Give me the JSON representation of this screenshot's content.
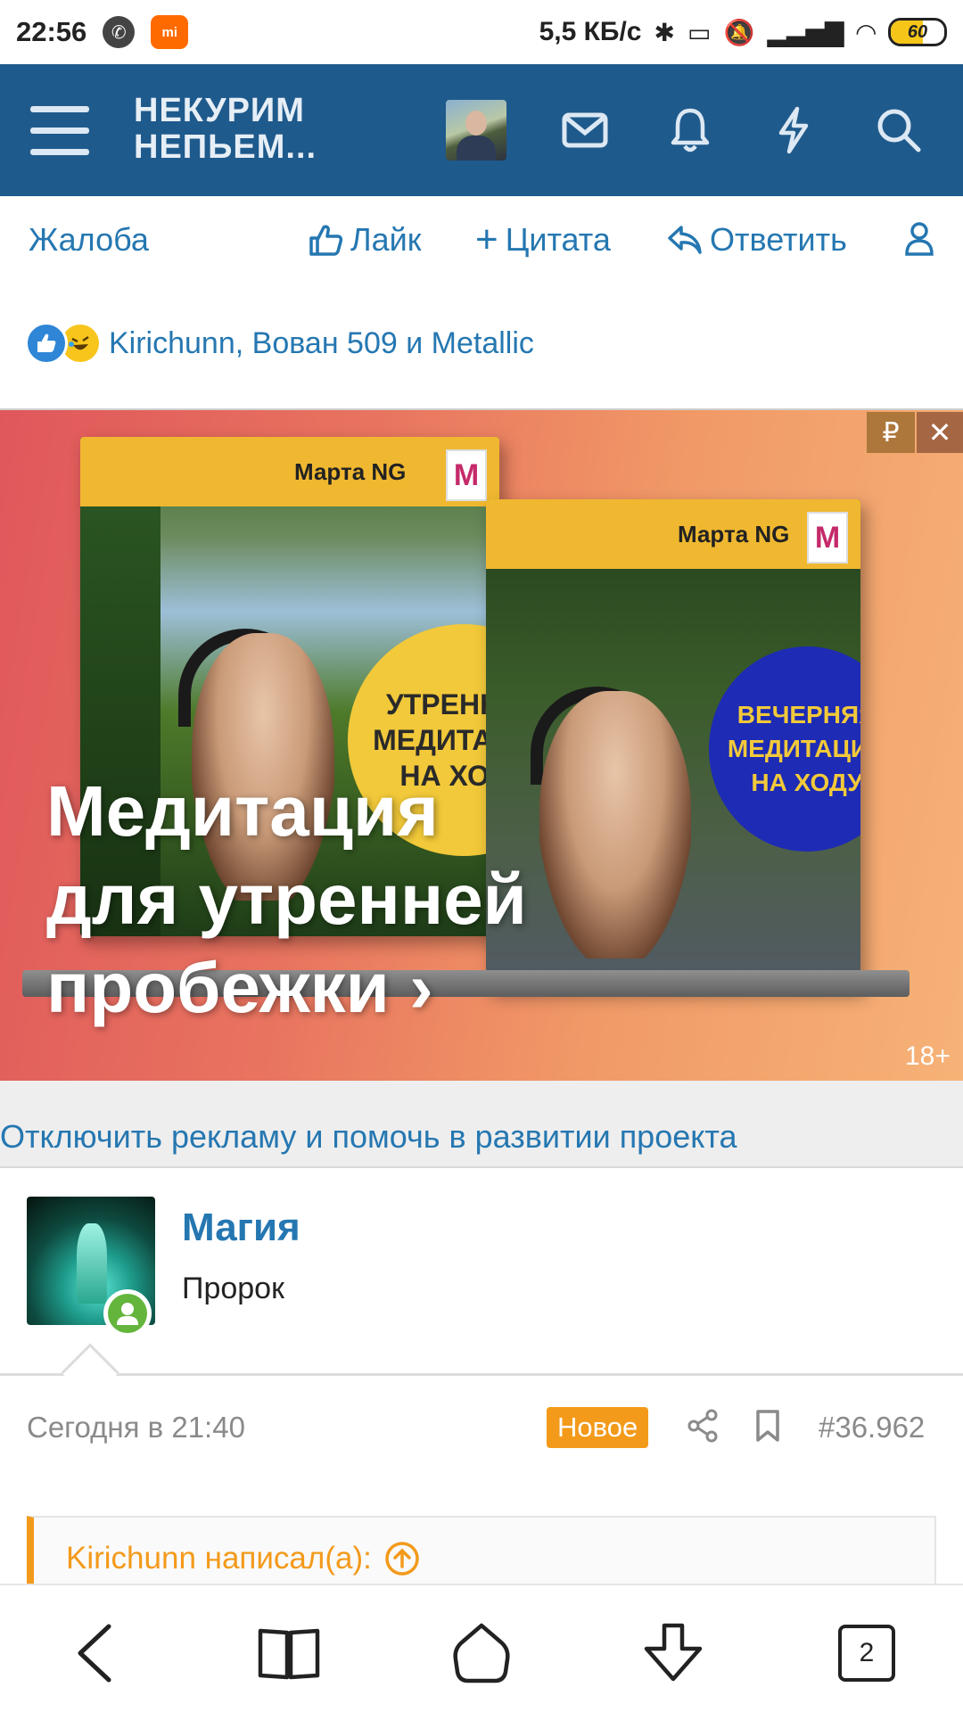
{
  "status_bar": {
    "time": "22:56",
    "speed": "5,5 КБ/с",
    "battery": "60",
    "battery_level_percent": 60,
    "icons": [
      "phone-icon",
      "mi-app-icon",
      "bluetooth-icon",
      "vibrate-icon",
      "mute-icon",
      "signal-icon",
      "wifi-icon",
      "battery-icon"
    ]
  },
  "header": {
    "logo_line1": "НЕКУРИМ",
    "logo_line2": "НЕПЬЕМ...",
    "icons": [
      "menu-icon",
      "avatar",
      "mail-icon",
      "bell-icon",
      "lightning-icon",
      "search-icon"
    ],
    "bg_color": "#1f5a8c"
  },
  "actions": {
    "report": "Жалоба",
    "like": "Лайк",
    "quote": "Цитата",
    "reply": "Ответить"
  },
  "reactions": {
    "users": "Kirichunn, Вован 509 и Metallic"
  },
  "ad": {
    "title_line1": "Медитация",
    "title_line2": "для утренней",
    "title_line3": "пробежки ›",
    "box1_brand": "Марта NG",
    "box1_circle_l1": "УТРЕННЯЯ",
    "box1_circle_l2": "МЕДИТАЦИЯ",
    "box1_circle_l3": "НА ХОДУ",
    "box2_brand": "Марта NG",
    "box2_circle_l1": "ВЕЧЕРНЯЯ",
    "box2_circle_l2": "МЕДИТАЦИЯ",
    "box2_circle_l3": "НА ХОДУ",
    "logo_letter": "M",
    "ruble": "₽",
    "close": "✕",
    "age": "18+"
  },
  "promo": {
    "text": "Отключить рекламу и помочь в развитии проекта"
  },
  "post": {
    "author_name": "Магия",
    "author_title": "Пророк",
    "date": "Сегодня в 21:40",
    "badge": "Новое",
    "number": "#36.962",
    "quote_author": "Kirichunn написал(а):"
  },
  "navbar": {
    "tabs_count": "2"
  },
  "colors": {
    "accent": "#2577b1",
    "badge": "#f39a1b",
    "online": "#63b53c"
  }
}
